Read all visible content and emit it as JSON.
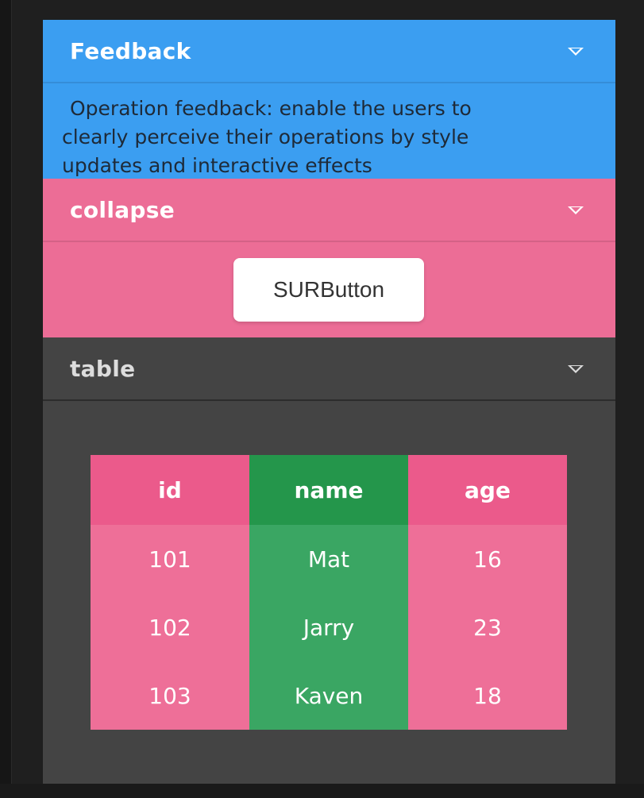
{
  "colors": {
    "feedback_bg": "#3b9ef1",
    "collapse_bg": "#ec6d96",
    "table_panel_bg": "#444444",
    "header_pink": "#eb5a8b",
    "header_green": "#24964b",
    "cell_pink": "#ee6f98",
    "cell_green": "#3aa663"
  },
  "feedback": {
    "title": "Feedback",
    "body_line1": "Operation feedback: enable the users to",
    "body_line2": "clearly perceive their operations by style",
    "body_line3": "updates and interactive effects",
    "toggle_icon": "caret-down-icon"
  },
  "collapse": {
    "title": "collapse",
    "button_label": "SURButton",
    "toggle_icon": "caret-down-icon"
  },
  "table": {
    "title": "table",
    "toggle_icon": "caret-down-icon",
    "columns": [
      "id",
      "name",
      "age"
    ],
    "rows": [
      [
        "101",
        "Mat",
        "16"
      ],
      [
        "102",
        "Jarry",
        "23"
      ],
      [
        "103",
        "Kaven",
        "18"
      ]
    ]
  }
}
